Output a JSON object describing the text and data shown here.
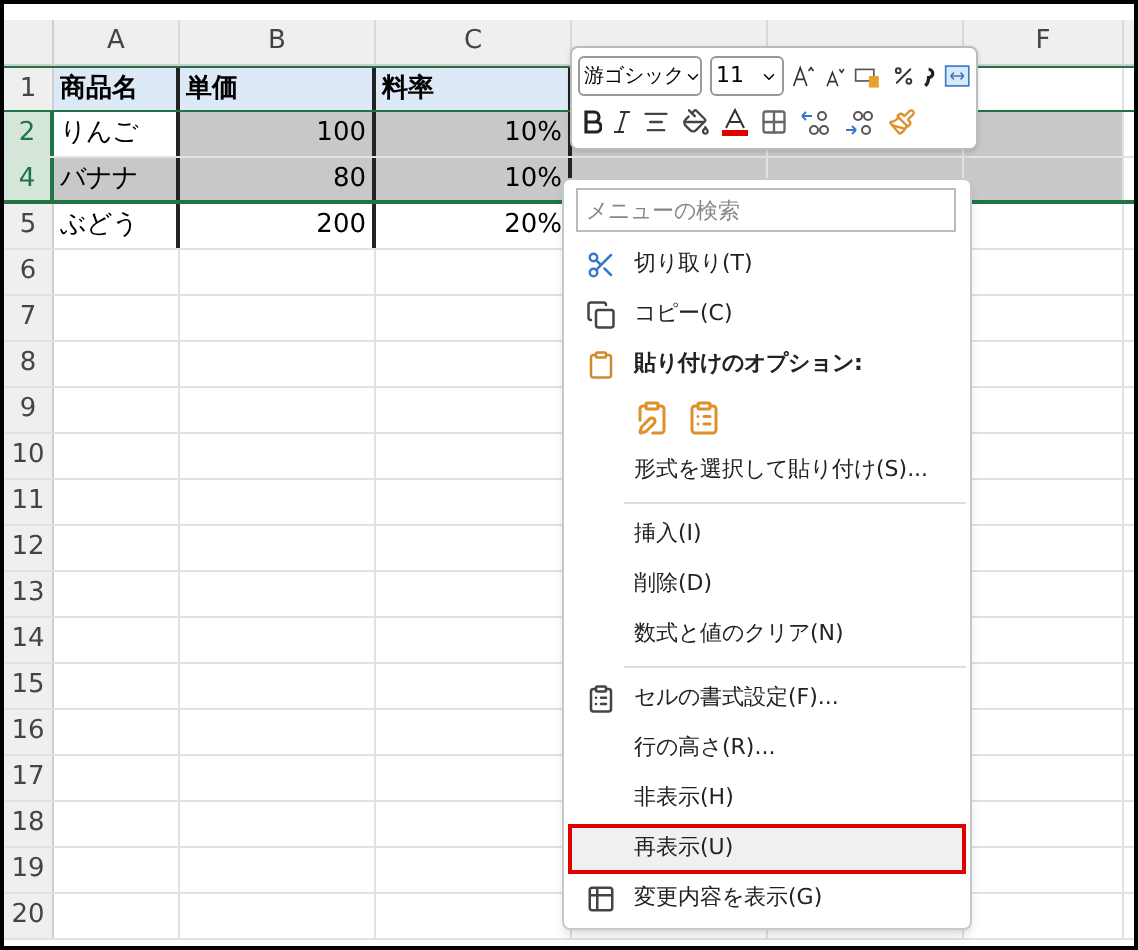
{
  "columns": [
    {
      "kind": "visible",
      "label": "A"
    },
    {
      "kind": "visible",
      "label": "B"
    },
    {
      "kind": "visible",
      "label": "C"
    },
    {
      "kind": "covered"
    },
    {
      "kind": "covered"
    },
    {
      "kind": "visible",
      "label": "F"
    }
  ],
  "rows": [
    {
      "number": "1",
      "kind": "header",
      "selected": false,
      "cells": [
        "商品名",
        "単価",
        "料率"
      ]
    },
    {
      "number": "2",
      "kind": "data",
      "selected": true,
      "cells": [
        "りんご",
        "100",
        "10%"
      ]
    },
    {
      "number": "4",
      "kind": "data",
      "selected": true,
      "cells": [
        "バナナ",
        "80",
        "10%"
      ]
    },
    {
      "number": "5",
      "kind": "data",
      "selected": false,
      "cells": [
        "ぶどう",
        "200",
        "20%"
      ]
    },
    {
      "number": "6",
      "kind": "blank",
      "selected": false
    },
    {
      "number": "7",
      "kind": "blank",
      "selected": false
    },
    {
      "number": "8",
      "kind": "blank",
      "selected": false
    },
    {
      "number": "9",
      "kind": "blank",
      "selected": false
    },
    {
      "number": "10",
      "kind": "blank",
      "selected": false
    },
    {
      "number": "11",
      "kind": "blank",
      "selected": false
    },
    {
      "number": "12",
      "kind": "blank",
      "selected": false
    },
    {
      "number": "13",
      "kind": "blank",
      "selected": false
    },
    {
      "number": "14",
      "kind": "blank",
      "selected": false
    },
    {
      "number": "15",
      "kind": "blank",
      "selected": false
    },
    {
      "number": "16",
      "kind": "blank",
      "selected": false
    },
    {
      "number": "17",
      "kind": "blank",
      "selected": false
    },
    {
      "number": "18",
      "kind": "blank",
      "selected": false
    },
    {
      "number": "19",
      "kind": "blank",
      "selected": false
    },
    {
      "number": "20",
      "kind": "blank",
      "selected": false
    }
  ],
  "mini_toolbar": {
    "font": "游ゴシック",
    "size": "11"
  },
  "context_menu": {
    "search": {
      "placeholder": "メニューの検索"
    },
    "items": [
      {
        "kind": "item",
        "label": "切り取り(T)",
        "highlighted": false
      },
      {
        "kind": "item",
        "label": "コピー(C)",
        "highlighted": false
      },
      {
        "kind": "heading",
        "label": "貼り付けのオプション:",
        "highlighted": false
      },
      {
        "kind": "paste-options"
      },
      {
        "kind": "item",
        "label": "形式を選択して貼り付け(S)...",
        "highlighted": false
      },
      {
        "kind": "separator"
      },
      {
        "kind": "item",
        "label": "挿入(I)",
        "highlighted": false
      },
      {
        "kind": "item",
        "label": "削除(D)",
        "highlighted": false
      },
      {
        "kind": "item",
        "label": "数式と値のクリア(N)",
        "highlighted": false
      },
      {
        "kind": "separator"
      },
      {
        "kind": "item",
        "label": "セルの書式設定(F)...",
        "highlighted": false
      },
      {
        "kind": "item",
        "label": "行の高さ(R)...",
        "highlighted": false
      },
      {
        "kind": "item",
        "label": "非表示(H)",
        "highlighted": false
      },
      {
        "kind": "item",
        "label": "再表示(U)",
        "highlighted": true
      },
      {
        "kind": "item",
        "label": "変更内容を表示(G)",
        "highlighted": false
      }
    ]
  }
}
